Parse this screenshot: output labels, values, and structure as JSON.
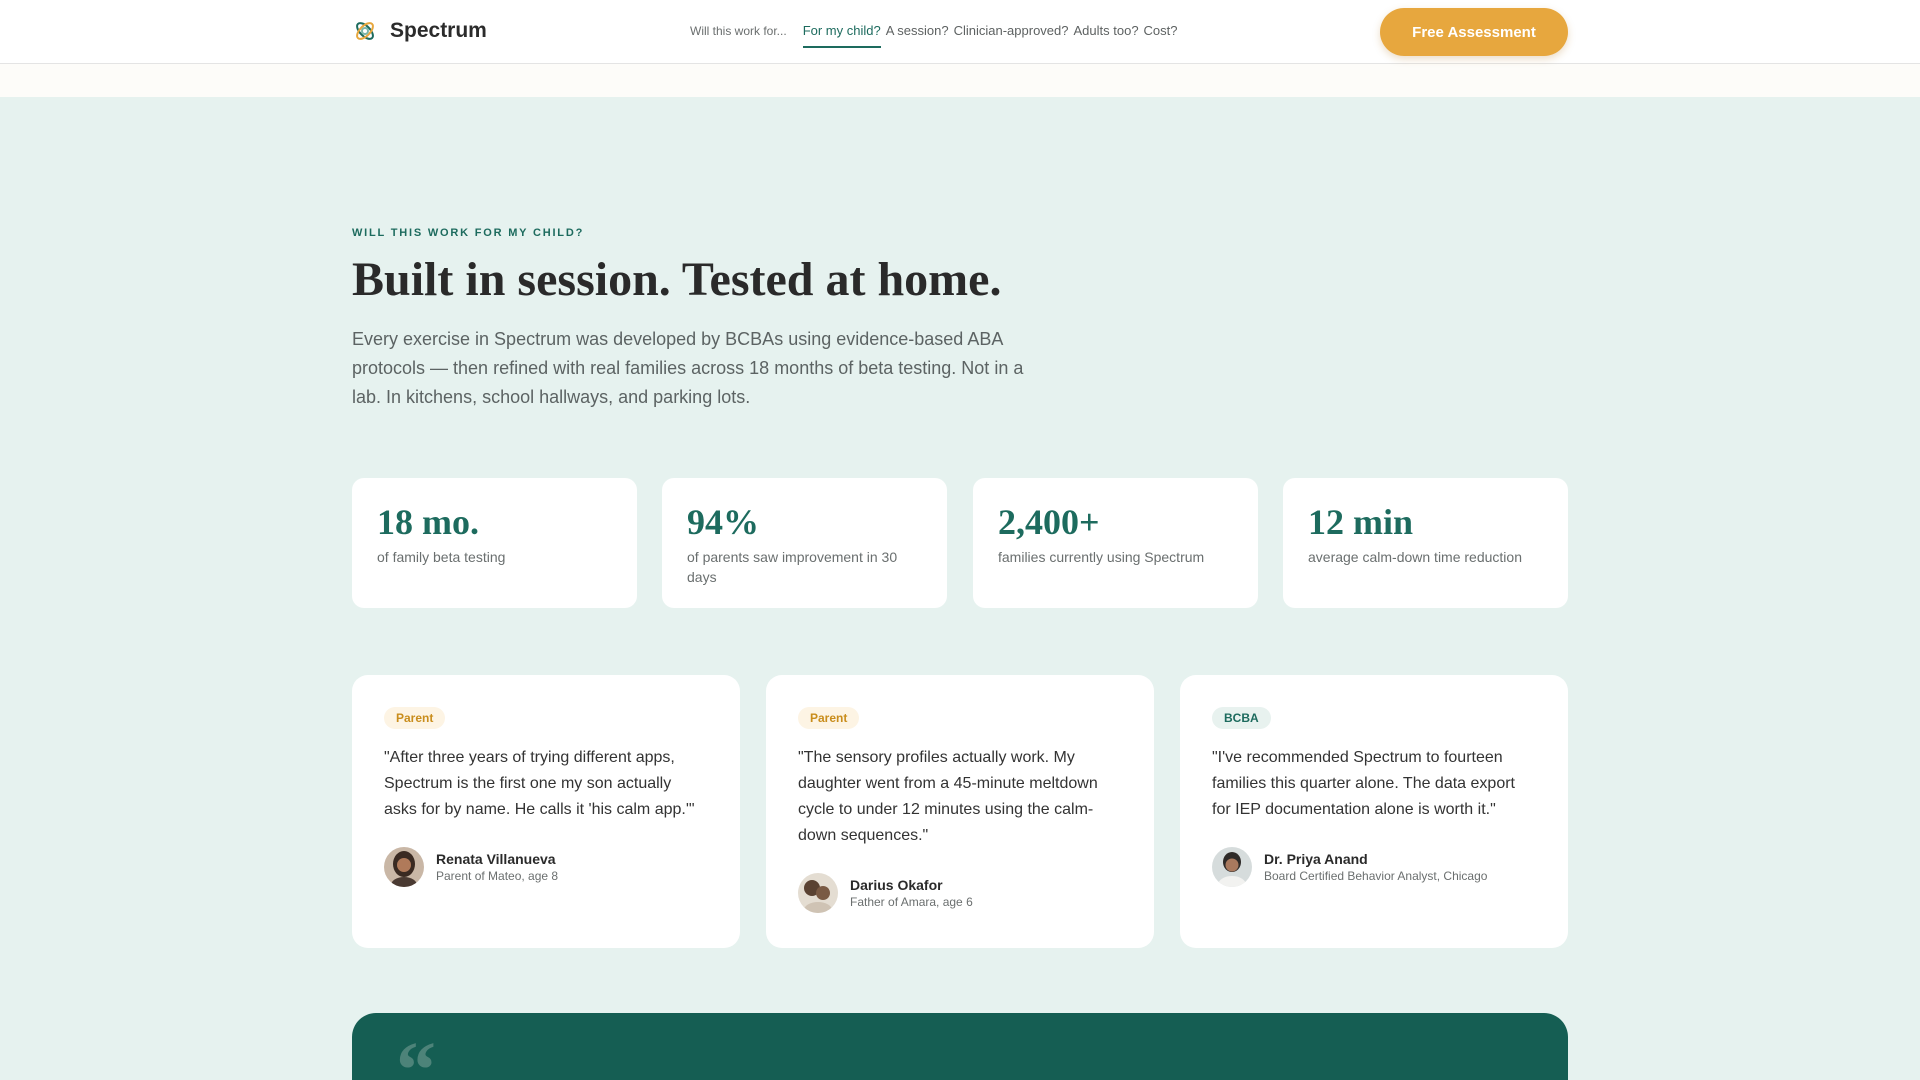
{
  "header": {
    "brand": "Spectrum",
    "nav_prefix": "Will this work for...",
    "nav_questions": [
      "For my child?",
      "A session?",
      "Clinician-approved?",
      "Adults too?",
      "Cost?"
    ],
    "cta": "Free Assessment"
  },
  "hero": {
    "eyebrow": "WILL THIS WORK FOR MY CHILD?",
    "headline": "Built in session. Tested at home.",
    "lede": "Every exercise in Spectrum was developed by BCBAs using evidence-based ABA protocols — then refined with real families across 18 months of beta testing. Not in a lab. In kitchens, school hallways, and parking lots."
  },
  "stats": [
    {
      "value": "18 mo.",
      "label": "of family beta testing"
    },
    {
      "value": "94%",
      "label": "of parents saw improvement in 30 days"
    },
    {
      "value": "2,400+",
      "label": "families currently using Spectrum"
    },
    {
      "value": "12 min",
      "label": "average calm-down time reduction"
    }
  ],
  "testimonials": [
    {
      "badge": "Parent",
      "quote": "\"After three years of trying different apps, Spectrum is the first one my son actually asks for by name. He calls it 'his calm app.'\"",
      "name": "Renata Villanueva",
      "role": "Parent of Mateo, age 8"
    },
    {
      "badge": "Parent",
      "quote": "\"The sensory profiles actually work. My daughter went from a 45-minute meltdown cycle to under 12 minutes using the calm-down sequences.\"",
      "name": "Darius Okafor",
      "role": "Father of Amara, age 6"
    },
    {
      "badge": "BCBA",
      "quote": "\"I've recommended Spectrum to fourteen families this quarter alone. The data export for IEP documentation alone is worth it.\"",
      "name": "Dr. Priya Anand",
      "role": "Board Certified Behavior Analyst, Chicago"
    }
  ],
  "banner": {
    "quote_mark": "“"
  },
  "colors": {
    "accent": "#1d6b5e",
    "cta": "#e7a73e",
    "background": "#e6f2ef",
    "banner": "#155e53"
  }
}
